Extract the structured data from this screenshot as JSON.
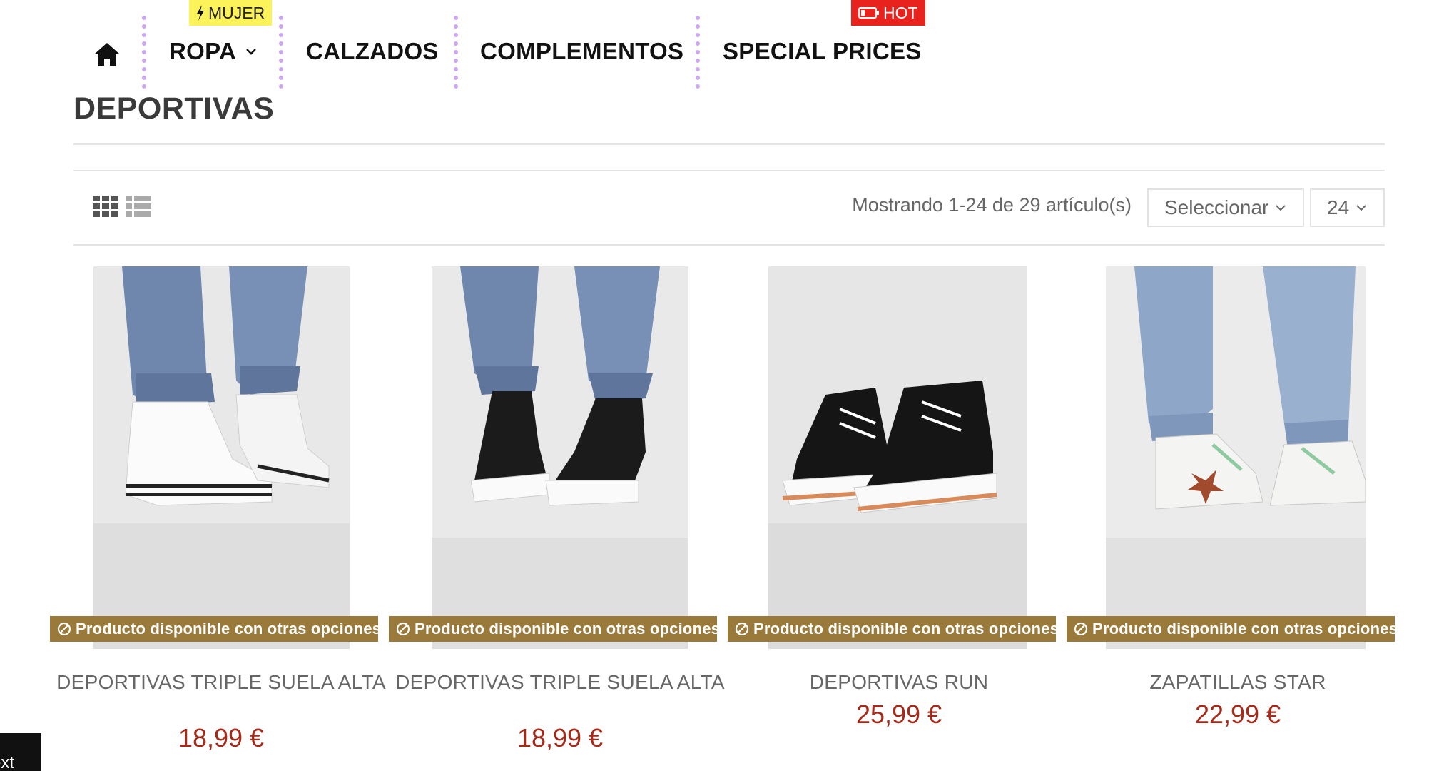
{
  "nav": {
    "items": [
      {
        "label": "ROPA",
        "has_dropdown": true
      },
      {
        "label": "CALZADOS",
        "has_dropdown": false
      },
      {
        "label": "COMPLEMENTOS",
        "has_dropdown": false
      },
      {
        "label": "SPECIAL PRICES",
        "has_dropdown": false
      }
    ],
    "badges": {
      "mujer": "MUJER",
      "hot": "HOT"
    },
    "home_icon": "home-icon",
    "separator_color": "#cda7f0"
  },
  "page": {
    "title": "DEPORTIVAS"
  },
  "toolbar": {
    "showing": "Mostrando 1-24 de 29 artículo(s)",
    "sort_label": "Seleccionar",
    "per_page": "24",
    "view_icons": [
      "grid-view-icon",
      "list-view-icon"
    ]
  },
  "products": [
    {
      "name": "DEPORTIVAS TRIPLE SUELA ALTA",
      "price": "18,99 €",
      "badge": "Producto disponible con otras opciones",
      "image": "white high-top platform sneakers"
    },
    {
      "name": "DEPORTIVAS TRIPLE SUELA ALTA",
      "price": "18,99 €",
      "badge": "Producto disponible con otras opciones",
      "image": "black high-top platform sneakers"
    },
    {
      "name": "DEPORTIVAS RUN",
      "price": "25,99 €",
      "badge": "Producto disponible con otras opciones",
      "image": "black high-top run sneakers"
    },
    {
      "name": "ZAPATILLAS STAR",
      "price": "22,99 €",
      "badge": "Producto disponible con otras opciones",
      "image": "white sneakers with star"
    }
  ],
  "next_tab": {
    "label": "ext"
  },
  "colors": {
    "badge_mujer": "#fcf25a",
    "badge_hot": "#e8231e",
    "availability_badge": "#9a7a3a",
    "price": "#a52a1a"
  }
}
